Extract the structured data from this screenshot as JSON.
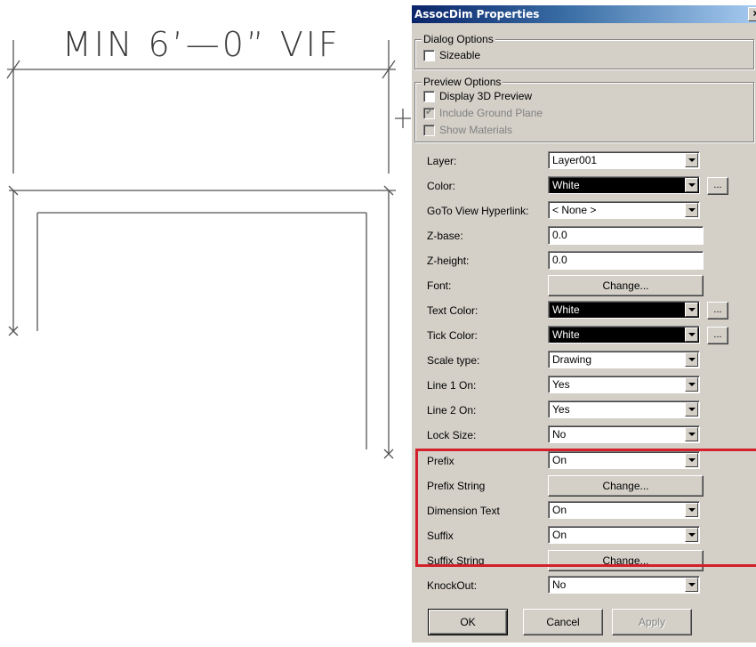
{
  "canvas": {
    "dimension_text": "MIN 6’—0” VIF"
  },
  "dialog": {
    "title": "AssocDim Properties",
    "close_glyph": "×",
    "dialog_options": {
      "legend": "Dialog Options",
      "sizeable_label": "Sizeable",
      "sizeable_checked": false
    },
    "preview_options": {
      "legend": "Preview Options",
      "display_3d_label": "Display 3D Preview",
      "display_3d_checked": false,
      "ground_plane_label": "Include Ground Plane",
      "ground_plane_checked": true,
      "show_materials_label": "Show Materials",
      "show_materials_checked": false
    },
    "properties": [
      {
        "label": "Layer:",
        "value": "Layer001"
      },
      {
        "label": "Color:",
        "value": "White",
        "ellipsis": "..."
      },
      {
        "label": "GoTo View Hyperlink:",
        "value": "< None >"
      },
      {
        "label": "Z-base:",
        "value": "0.0"
      },
      {
        "label": "Z-height:",
        "value": "0.0"
      },
      {
        "label": "Font:",
        "value": "Change..."
      },
      {
        "label": "Text Color:",
        "value": "White",
        "ellipsis": "..."
      },
      {
        "label": "Tick Color:",
        "value": "White",
        "ellipsis": "..."
      },
      {
        "label": "Scale type:",
        "value": "Drawing"
      },
      {
        "label": "Line 1 On:",
        "value": "Yes"
      },
      {
        "label": "Line 2 On:",
        "value": "Yes"
      },
      {
        "label": "Lock Size:",
        "value": "No"
      },
      {
        "label": "Prefix",
        "value": "On"
      },
      {
        "label": "Prefix String",
        "value": "Change..."
      },
      {
        "label": "Dimension Text",
        "value": "On"
      },
      {
        "label": "Suffix",
        "value": "On"
      },
      {
        "label": "Suffix String",
        "value": "Change..."
      },
      {
        "label": "KnockOut:",
        "value": "No"
      }
    ],
    "buttons": {
      "ok": "OK",
      "cancel": "Cancel",
      "apply": "Apply"
    }
  },
  "colors": {
    "dialog_bg": "#d4d0c8",
    "titlebar": "#0a246a",
    "highlight": "#d3202a",
    "swatch_white_field": "#000000"
  }
}
